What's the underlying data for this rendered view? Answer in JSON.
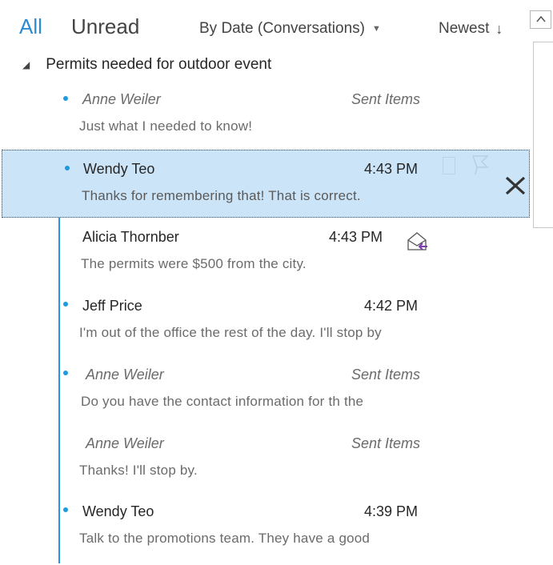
{
  "filter_bar": {
    "all_label": "All",
    "unread_label": "Unread",
    "sort_by_label": "By Date (Conversations)",
    "sort_order_label": "Newest",
    "sort_arrow": "↓",
    "caret": "▼"
  },
  "conversation": {
    "expand_glyph": "◢",
    "subject": "Permits needed for outdoor event"
  },
  "messages": [
    {
      "sender": "Anne Weiler",
      "meta": "Sent Items",
      "preview": "Just what I needed to know!",
      "unread_dot": true,
      "sent": true
    },
    {
      "sender": "Wendy Teo",
      "meta": "4:43 PM",
      "preview": "Thanks for remembering that! That is correct.",
      "unread_dot": true,
      "selected": true
    },
    {
      "sender": "Alicia Thornber",
      "meta": "4:43 PM",
      "preview": "The permits were $500 from the city.",
      "unread_dot": false,
      "icon": "replied-envelope-icon"
    },
    {
      "sender": "Jeff Price",
      "meta": "4:42 PM",
      "preview": "I'm out of the office the rest of the day. I'll stop by",
      "unread_dot": true
    },
    {
      "sender": "Anne Weiler",
      "meta": "Sent Items",
      "preview": "Do you have the contact information for th the",
      "unread_dot": true,
      "sent": true
    },
    {
      "sender": "Anne Weiler",
      "meta": "Sent Items",
      "preview": "Thanks! I'll stop by.",
      "unread_dot": false,
      "sent": true
    },
    {
      "sender": "Wendy Teo",
      "meta": "4:39 PM",
      "preview": "Talk to the promotions team. They have a good",
      "unread_dot": true
    }
  ],
  "colors": {
    "accent": "#2a8dd4",
    "selection": "#cce4f7",
    "thread_line": "#1f9ae0",
    "reply_arrow": "#7a3fb0"
  }
}
